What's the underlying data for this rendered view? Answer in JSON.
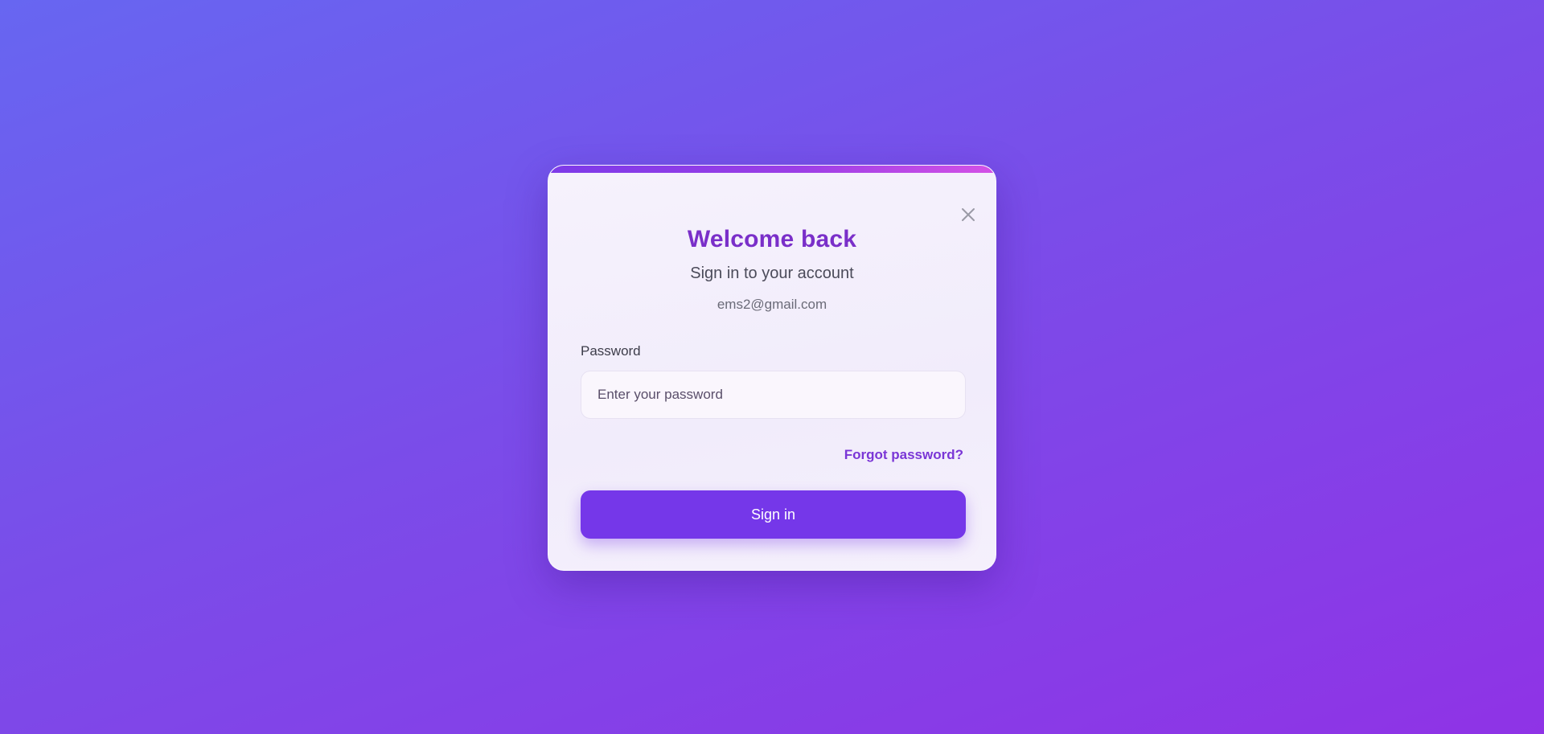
{
  "modal": {
    "title": "Welcome back",
    "subtitle": "Sign in to your account",
    "email": "ems2@gmail.com",
    "close_icon": "close-icon"
  },
  "form": {
    "password_label": "Password",
    "password_placeholder": "Enter your password",
    "password_value": "",
    "forgot_link": "Forgot password?",
    "submit_label": "Sign in"
  },
  "colors": {
    "accent": "#7537e9",
    "title": "#7a2fc9",
    "gradient_start": "#6766f1",
    "gradient_end": "#8f33e6"
  }
}
